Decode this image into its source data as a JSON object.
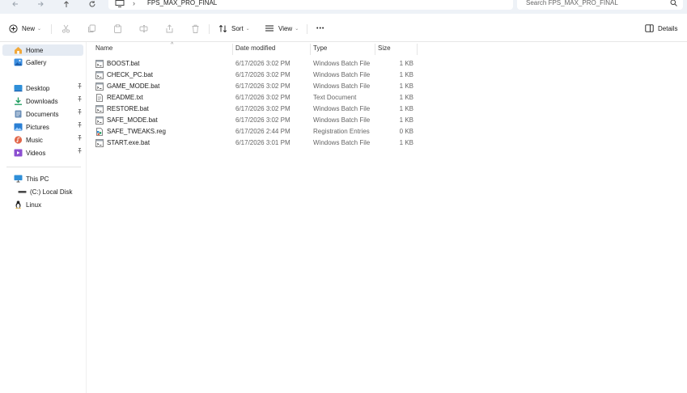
{
  "window": {
    "address": {
      "separator": "›",
      "crumb": "FPS_MAX_PRO_FINAL"
    },
    "search": {
      "placeholder": "Search FPS_MAX_PRO_FINAL"
    }
  },
  "toolbar": {
    "new_label": "New",
    "sort_label": "Sort",
    "view_label": "View",
    "more_label": "•••",
    "details_label": "Details",
    "caret": "⌄"
  },
  "sidebar": {
    "pin_glyph": "📌",
    "quick": [
      {
        "label": "Home",
        "icon": "home-icon"
      },
      {
        "label": "Gallery",
        "icon": "gallery-icon"
      }
    ],
    "pinned": [
      {
        "label": "Desktop",
        "icon": "desktop-icon"
      },
      {
        "label": "Downloads",
        "icon": "downloads-icon"
      },
      {
        "label": "Documents",
        "icon": "documents-icon"
      },
      {
        "label": "Pictures",
        "icon": "pictures-icon"
      },
      {
        "label": "Music",
        "icon": "music-icon"
      },
      {
        "label": "Videos",
        "icon": "videos-icon"
      }
    ],
    "devices": [
      {
        "label": "This PC",
        "icon": "pc-icon"
      },
      {
        "label": "(C:) Local Disk",
        "icon": "disk-icon"
      },
      {
        "label": "Linux",
        "icon": "linux-icon"
      }
    ]
  },
  "file_list": {
    "columns": {
      "name": "Name",
      "date": "Date modified",
      "type": "Type",
      "size": "Size"
    },
    "sort_indicator": "^",
    "files": [
      {
        "name": "BOOST.bat",
        "date": "6/17/2026 3:02 PM",
        "type": "Windows Batch File",
        "size": "1 KB",
        "icon": "batch-file-icon"
      },
      {
        "name": "CHECK_PC.bat",
        "date": "6/17/2026 3:02 PM",
        "type": "Windows Batch File",
        "size": "1 KB",
        "icon": "batch-file-icon"
      },
      {
        "name": "GAME_MODE.bat",
        "date": "6/17/2026 3:02 PM",
        "type": "Windows Batch File",
        "size": "1 KB",
        "icon": "batch-file-icon"
      },
      {
        "name": "README.txt",
        "date": "6/17/2026 3:02 PM",
        "type": "Text Document",
        "size": "1 KB",
        "icon": "text-file-icon"
      },
      {
        "name": "RESTORE.bat",
        "date": "6/17/2026 3:02 PM",
        "type": "Windows Batch File",
        "size": "1 KB",
        "icon": "batch-file-icon"
      },
      {
        "name": "SAFE_MODE.bat",
        "date": "6/17/2026 3:02 PM",
        "type": "Windows Batch File",
        "size": "1 KB",
        "icon": "batch-file-icon"
      },
      {
        "name": "SAFE_TWEAKS.reg",
        "date": "6/17/2026 2:44 PM",
        "type": "Registration Entries",
        "size": "0 KB",
        "icon": "registry-file-icon"
      },
      {
        "name": "START.exe.bat",
        "date": "6/17/2026 3:01 PM",
        "type": "Windows Batch File",
        "size": "1 KB",
        "icon": "batch-file-icon"
      }
    ]
  },
  "colors": {
    "accent": "#0067c0",
    "selected_bg": "#e5ebf3",
    "titlebar_bg": "#eef2f7"
  }
}
